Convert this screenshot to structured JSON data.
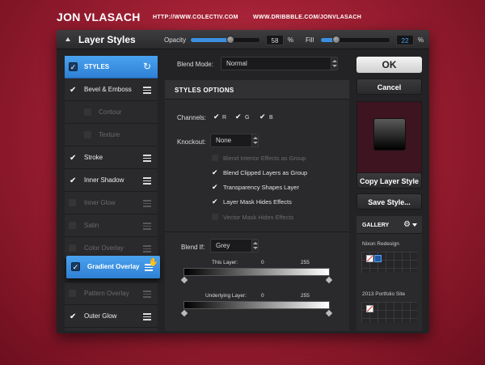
{
  "header": {
    "brand": "JON VLASACH",
    "link1": "HTTP://WWW.COLECTIV.COM",
    "link2": "WWW.DRIBBBLE.COM/JONVLASACH"
  },
  "window": {
    "title": "Layer Styles",
    "opacity_label": "Opacity",
    "opacity_value": "58",
    "opacity_level": 58,
    "fill_label": "Fill",
    "fill_value": "22",
    "fill_level": 22,
    "percent": "%"
  },
  "styles_list": [
    {
      "label": "STYLES",
      "state": "active"
    },
    {
      "label": "Bevel & Emboss",
      "state": "checked"
    },
    {
      "label": "Contour",
      "state": "sub"
    },
    {
      "label": "Texture",
      "state": "sub"
    },
    {
      "label": "Stroke",
      "state": "checked"
    },
    {
      "label": "Inner Shadow",
      "state": "checked"
    },
    {
      "label": "Inner Glow",
      "state": "dim"
    },
    {
      "label": "Satin",
      "state": "dim"
    },
    {
      "label": "Color Overlay",
      "state": "dim"
    },
    {
      "label": "Gradient Overlay",
      "state": "hidden"
    },
    {
      "label": "Pattern Overlay",
      "state": "dim"
    },
    {
      "label": "Outer Glow",
      "state": "checked"
    }
  ],
  "dragging_item": {
    "label": "Gradient Overlay"
  },
  "blend_mode": {
    "label": "Blend Mode:",
    "value": "Normal"
  },
  "styles_options": {
    "header": "STYLES OPTIONS",
    "channels_label": "Channels:",
    "channels": [
      "R",
      "G",
      "B"
    ],
    "knockout_label": "Knockout:",
    "knockout_value": "None",
    "options": [
      {
        "label": "Blend Interior Effects as Group",
        "checked": false
      },
      {
        "label": "Blend Clipped Layers as Group",
        "checked": true
      },
      {
        "label": "Transparency Shapes Layer",
        "checked": true
      },
      {
        "label": "Layer Mask Hides Effects",
        "checked": true
      },
      {
        "label": "Vector Mask Hides Effects",
        "checked": false
      }
    ],
    "blend_if_label": "Blend If:",
    "blend_if_value": "Grey",
    "this_layer_label": "This Layer:",
    "this_layer_min": "0",
    "this_layer_max": "255",
    "underlying_label": "Underlying Layer:",
    "underlying_min": "0",
    "underlying_max": "255"
  },
  "buttons": {
    "ok": "OK",
    "cancel": "Cancel",
    "copy": "Copy Layer Style",
    "save": "Save Style..."
  },
  "gallery": {
    "title": "GALLERY",
    "items": [
      "Nixon Redesign",
      "2013 Portfolio Site"
    ]
  },
  "colors": {
    "accent": "#3b8fe0",
    "bg": "#a01f33",
    "panel": "#232224"
  }
}
